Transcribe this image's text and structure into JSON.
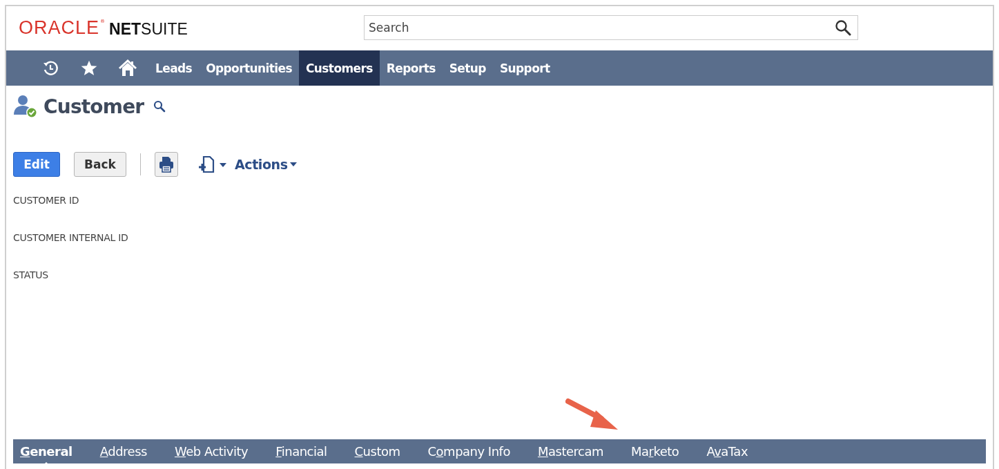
{
  "logo": {
    "brand": "ORACLE",
    "mark": "®",
    "product_bold": "NET",
    "product_rest": "SUITE"
  },
  "search": {
    "placeholder": "Search"
  },
  "nav": {
    "icons": [
      {
        "kind": "recent"
      },
      {
        "kind": "favorites"
      },
      {
        "kind": "home"
      }
    ],
    "items": [
      {
        "label": "Leads",
        "selected": false
      },
      {
        "label": "Opportunities",
        "selected": false
      },
      {
        "label": "Customers",
        "selected": true
      },
      {
        "label": "Reports",
        "selected": false
      },
      {
        "label": "Setup",
        "selected": false
      },
      {
        "label": "Support",
        "selected": false
      }
    ]
  },
  "page": {
    "title": "Customer"
  },
  "toolbar": {
    "edit": "Edit",
    "back": "Back",
    "actions": "Actions"
  },
  "fields": [
    "CUSTOMER ID",
    "CUSTOMER INTERNAL ID",
    "STATUS"
  ],
  "subtabs": [
    {
      "key": "G",
      "post": "eneral",
      "selected": true
    },
    {
      "key": "A",
      "post": "ddress",
      "selected": false
    },
    {
      "key": "W",
      "post": "eb Activity",
      "selected": false
    },
    {
      "key": "F",
      "post": "inancial",
      "selected": false
    },
    {
      "key": "C",
      "post": "ustom",
      "selected": false
    },
    {
      "pre": "C",
      "key": "o",
      "post": "mpany Info",
      "selected": false
    },
    {
      "key": "M",
      "post": "astercam",
      "selected": false
    },
    {
      "pre": "Ma",
      "key": "r",
      "post": "keto",
      "selected": false
    },
    {
      "pre": "A",
      "key": "v",
      "post": "aTax",
      "selected": false
    }
  ]
}
